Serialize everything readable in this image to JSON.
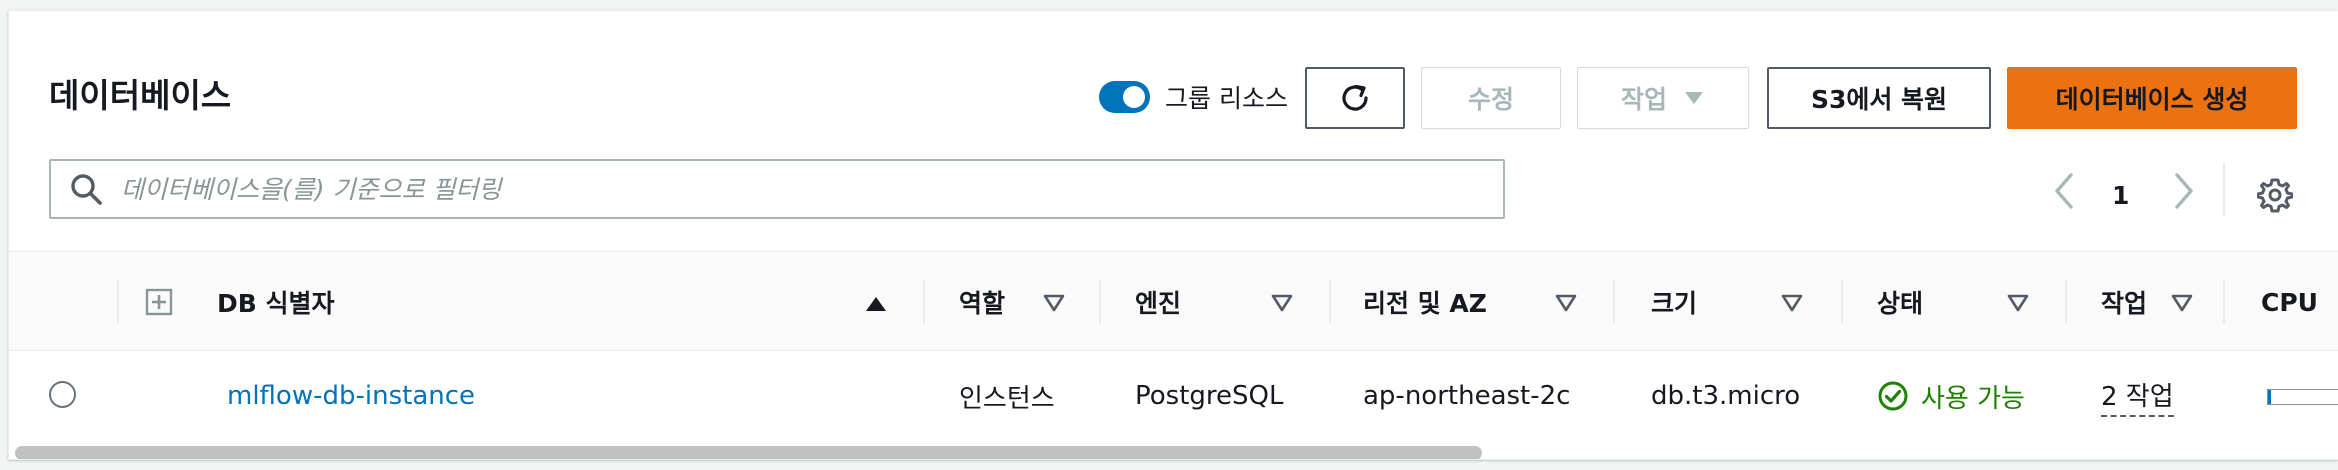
{
  "header": {
    "title": "데이터베이스",
    "group_toggle_label": "그룹 리소스",
    "group_toggle_on": true,
    "refresh_icon": "refresh-icon",
    "modify_label": "수정",
    "actions_label": "작업",
    "restore_s3_label": "S3에서 복원",
    "create_db_label": "데이터베이스 생성"
  },
  "search": {
    "placeholder": "데이터베이스을(를) 기준으로 필터링",
    "value": ""
  },
  "pagination": {
    "current_page": "1"
  },
  "table": {
    "columns": [
      {
        "key": "db_id",
        "label": "DB 식별자",
        "sort": "asc"
      },
      {
        "key": "role",
        "label": "역할",
        "sort": "none"
      },
      {
        "key": "engine",
        "label": "엔진",
        "sort": "none"
      },
      {
        "key": "region_az",
        "label": "리전 및 AZ",
        "sort": "none"
      },
      {
        "key": "size",
        "label": "크기",
        "sort": "none"
      },
      {
        "key": "status",
        "label": "상태",
        "sort": "none"
      },
      {
        "key": "actions",
        "label": "작업",
        "sort": "none"
      },
      {
        "key": "cpu",
        "label": "CPU",
        "sort": "none"
      }
    ],
    "rows": [
      {
        "db_id": "mlflow-db-instance",
        "role": "인스턴스",
        "engine": "PostgreSQL",
        "region_az": "ap-northeast-2c",
        "size": "db.t3.micro",
        "status": "사용 가능",
        "actions": "2 작업",
        "cpu_fraction": 0.04
      }
    ]
  },
  "colors": {
    "accent": "#0073bb",
    "primary_button": "#ec7211",
    "status_ok": "#1d8102"
  }
}
